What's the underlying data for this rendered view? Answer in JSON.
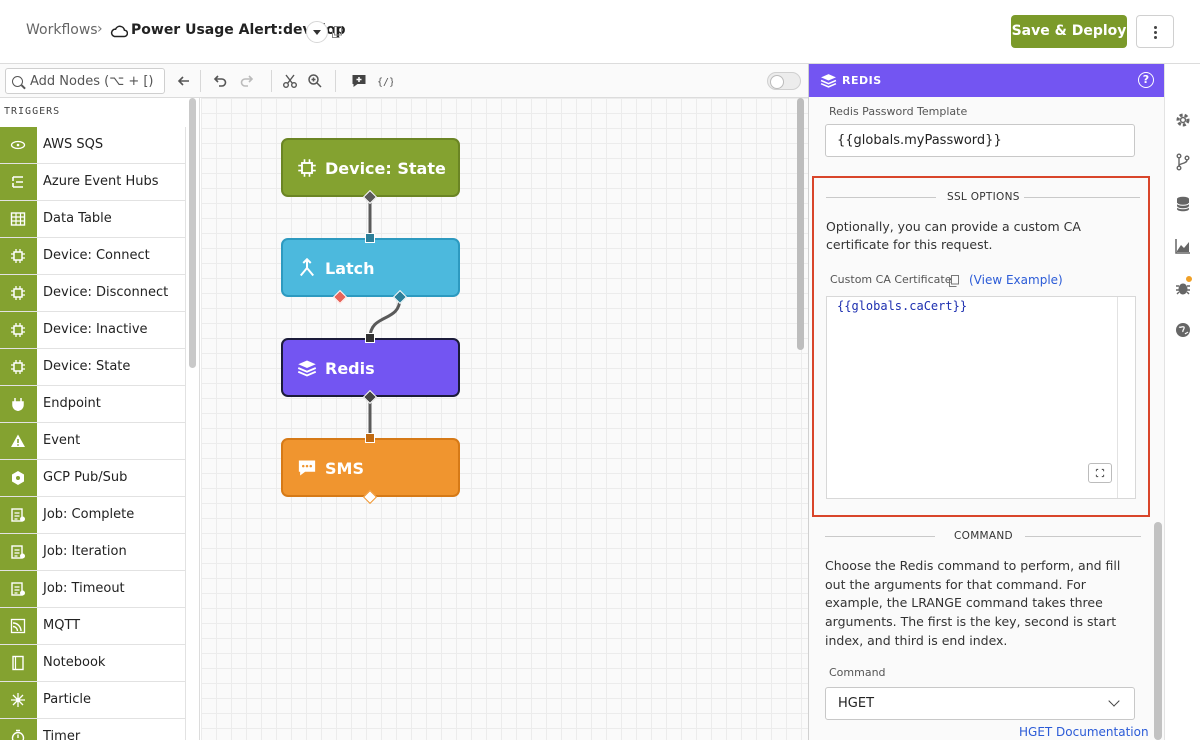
{
  "header": {
    "breadcrumb_root": "Workflows",
    "breadcrumb_sep": "›",
    "workflow_name": "Power Usage Alert:develop",
    "deploy_label": "Save & Deploy"
  },
  "toolbar": {
    "search_placeholder": "Add Nodes (⌥ + [)",
    "icons": [
      "search-icon",
      "arrow-left-icon",
      "undo-icon",
      "redo-icon",
      "scissors-icon",
      "zoom-icon",
      "comment-add-icon",
      "variable-icon",
      "toggle"
    ]
  },
  "nodelist": {
    "section_title": "TRIGGERS",
    "accent": "#84a230",
    "items": [
      {
        "label": "AWS SQS",
        "icon": "aws-icon"
      },
      {
        "label": "Azure Event Hubs",
        "icon": "azure-icon"
      },
      {
        "label": "Data Table",
        "icon": "table-icon"
      },
      {
        "label": "Device: Connect",
        "icon": "chip-icon"
      },
      {
        "label": "Device: Disconnect",
        "icon": "chip-icon"
      },
      {
        "label": "Device: Inactive",
        "icon": "chip-icon"
      },
      {
        "label": "Device: State",
        "icon": "chip-icon"
      },
      {
        "label": "Endpoint",
        "icon": "plug-icon"
      },
      {
        "label": "Event",
        "icon": "warning-icon"
      },
      {
        "label": "GCP Pub/Sub",
        "icon": "gcp-icon"
      },
      {
        "label": "Job: Complete",
        "icon": "job-icon"
      },
      {
        "label": "Job: Iteration",
        "icon": "job-icon"
      },
      {
        "label": "Job: Timeout",
        "icon": "job-icon"
      },
      {
        "label": "MQTT",
        "icon": "mqtt-icon"
      },
      {
        "label": "Notebook",
        "icon": "notebook-icon"
      },
      {
        "label": "Particle",
        "icon": "particle-icon"
      },
      {
        "label": "Timer",
        "icon": "timer-icon"
      }
    ]
  },
  "canvas": {
    "nodes": [
      {
        "label": "Device: State",
        "color": "#84a230",
        "border": "#6b8524",
        "icon": "chip-icon"
      },
      {
        "label": "Latch",
        "color": "#4cb9dd",
        "border": "#2d9ac0",
        "icon": "latch-icon"
      },
      {
        "label": "Redis",
        "color": "#7355f2",
        "border": "#1b1b3a",
        "icon": "redis-icon"
      },
      {
        "label": "SMS",
        "color": "#f0952f",
        "border": "#d67a17",
        "icon": "sms-icon"
      }
    ]
  },
  "panel": {
    "title": "REDIS",
    "header_color": "#7355f2",
    "password_label": "Redis Password Template",
    "password_value": "{{globals.myPassword}}",
    "ssl_title": "SSL OPTIONS",
    "ssl_desc": "Optionally, you can provide a custom CA certificate for this request.",
    "ca_label": "Custom CA Certificate",
    "ca_link": "(View Example)",
    "ca_value": "{{globals.caCert}}",
    "highlight_color": "#d9452a",
    "command_title": "COMMAND",
    "command_desc": "Choose the Redis command to perform, and fill out the arguments for that command. For example, the LRANGE command takes three arguments. The first is the key, second is start index, and third is end index.",
    "command_label": "Command",
    "command_value": "HGET",
    "doc_link": "HGET Documentation"
  },
  "rail": {
    "icons": [
      "gear-icon",
      "branch-icon",
      "database-icon",
      "chart-icon",
      "bug-icon",
      "globe-icon"
    ]
  }
}
